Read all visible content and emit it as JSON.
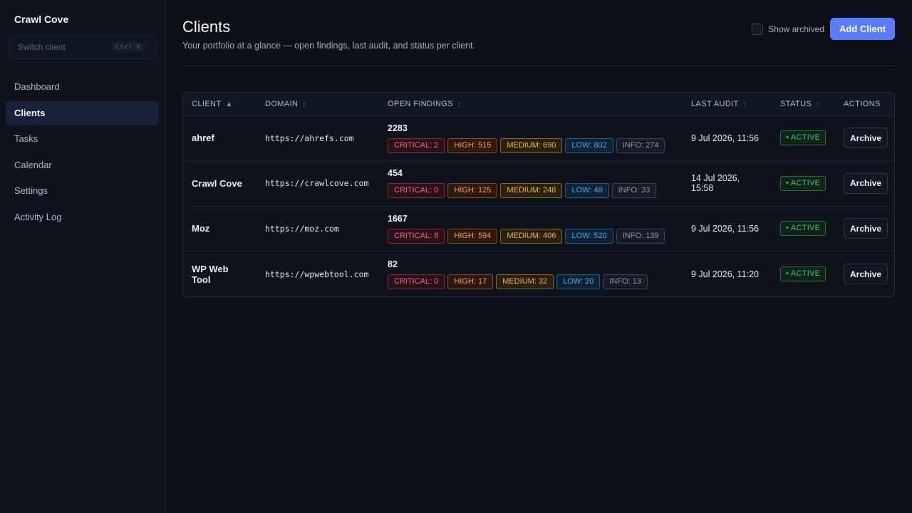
{
  "sidebar": {
    "brand": "Crawl Cove",
    "switcher_placeholder": "Switch client",
    "switcher_shortcut": "Ctrl K",
    "items": [
      {
        "label": "Dashboard"
      },
      {
        "label": "Clients"
      },
      {
        "label": "Tasks"
      },
      {
        "label": "Calendar"
      },
      {
        "label": "Settings"
      },
      {
        "label": "Activity Log"
      }
    ],
    "active_index": 1
  },
  "header": {
    "title": "Clients",
    "subtitle": "Your portfolio at a glance — open findings, last audit, and status per client.",
    "show_archived_label": "Show archived",
    "show_archived_checked": false,
    "add_button_label": "Add Client"
  },
  "table": {
    "columns": [
      {
        "label": "CLIENT",
        "sort_icon": "▲"
      },
      {
        "label": "DOMAIN",
        "sort_icon": "↕"
      },
      {
        "label": "OPEN FINDINGS",
        "sort_icon": "↕"
      },
      {
        "label": "LAST AUDIT",
        "sort_icon": "↕"
      },
      {
        "label": "STATUS",
        "sort_icon": "↕"
      },
      {
        "label": "ACTIONS",
        "sort_icon": ""
      }
    ],
    "rows": [
      {
        "client": "ahref",
        "domain": "https://ahrefs.com",
        "total": "2283",
        "critical": "CRITICAL: 2",
        "high": "HIGH: 515",
        "medium": "MEDIUM: 690",
        "low": "LOW: 802",
        "info": "INFO: 274",
        "last_audit": "9 Jul 2026, 11:56",
        "status": "• ACTIVE",
        "action": "Archive"
      },
      {
        "client": "Crawl Cove",
        "domain": "https://crawlcove.com",
        "total": "454",
        "critical": "CRITICAL: 0",
        "high": "HIGH: 125",
        "medium": "MEDIUM: 248",
        "low": "LOW: 48",
        "info": "INFO: 33",
        "last_audit": "14 Jul 2026, 15:58",
        "status": "• ACTIVE",
        "action": "Archive"
      },
      {
        "client": "Moz",
        "domain": "https://moz.com",
        "total": "1667",
        "critical": "CRITICAL: 8",
        "high": "HIGH: 594",
        "medium": "MEDIUM: 406",
        "low": "LOW: 520",
        "info": "INFO: 139",
        "last_audit": "9 Jul 2026, 11:56",
        "status": "• ACTIVE",
        "action": "Archive"
      },
      {
        "client": "WP Web Tool",
        "domain": "https://wpwebtool.com",
        "total": "82",
        "critical": "CRITICAL: 0",
        "high": "HIGH: 17",
        "medium": "MEDIUM: 32",
        "low": "LOW: 20",
        "info": "INFO: 13",
        "last_audit": "9 Jul 2026, 11:20",
        "status": "• ACTIVE",
        "action": "Archive"
      }
    ]
  },
  "colors": {
    "accent": "#5b7cfa",
    "critical": "#ff5d7a",
    "high": "#ff9a4f",
    "medium": "#f3b13d",
    "low": "#3fa9f5",
    "info": "#8d96a5",
    "active": "#43c76a"
  }
}
